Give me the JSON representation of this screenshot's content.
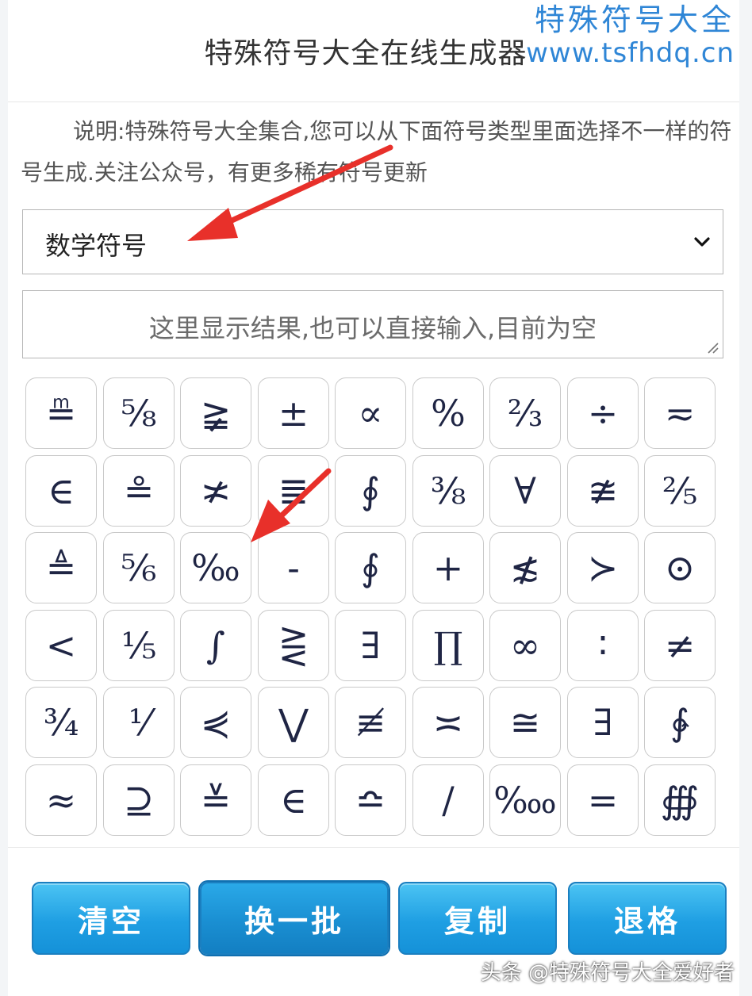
{
  "page": {
    "title": "特殊符号大全在线生成器",
    "description": "说明:特殊符号大全集合,您可以从下面符号类型里面选择不一样的符号生成.关注公众号，有更多稀有符号更新"
  },
  "watermark": {
    "name": "特殊符号大全",
    "url": "www.tsfhdq.cn",
    "footer": "头条 @特殊符号大全爱好者"
  },
  "category_select": {
    "selected": "数学符号"
  },
  "result_box": {
    "placeholder": "这里显示结果,也可以直接输入,目前为空"
  },
  "symbols": [
    [
      "≞",
      "⅝",
      "≩",
      "±",
      "∝",
      "%",
      "⅔",
      "÷",
      "≂"
    ],
    [
      "∈",
      "≗",
      "≭",
      "≣",
      "∮",
      "⅜",
      "∀",
      "≇",
      "⅖"
    ],
    [
      "≜",
      "⅚",
      "‰",
      "-",
      "∮",
      "+",
      "≴",
      "≻",
      "⊙"
    ],
    [
      "<",
      "⅕",
      "∫",
      "⋛",
      "∃",
      "∏",
      "∞",
      "∶",
      "≠"
    ],
    [
      "¾",
      "⅟",
      "⋞",
      "⋁",
      "≢",
      "≍",
      "≅",
      "∃",
      "∳"
    ],
    [
      "≈",
      "⊇",
      "≚",
      "∈",
      "≏",
      "∕",
      "‱",
      "=",
      "∰"
    ]
  ],
  "buttons": {
    "clear": "清空",
    "refresh": "换一批",
    "copy": "复制",
    "backspace": "退格"
  },
  "colors": {
    "accent_button": "#1f9fe3",
    "watermark": "#2f86d6",
    "arrow": "#e8302a"
  },
  "icons": {
    "select_chevron": "chevron-down-icon",
    "resize_grip": "resize-grip-icon"
  }
}
